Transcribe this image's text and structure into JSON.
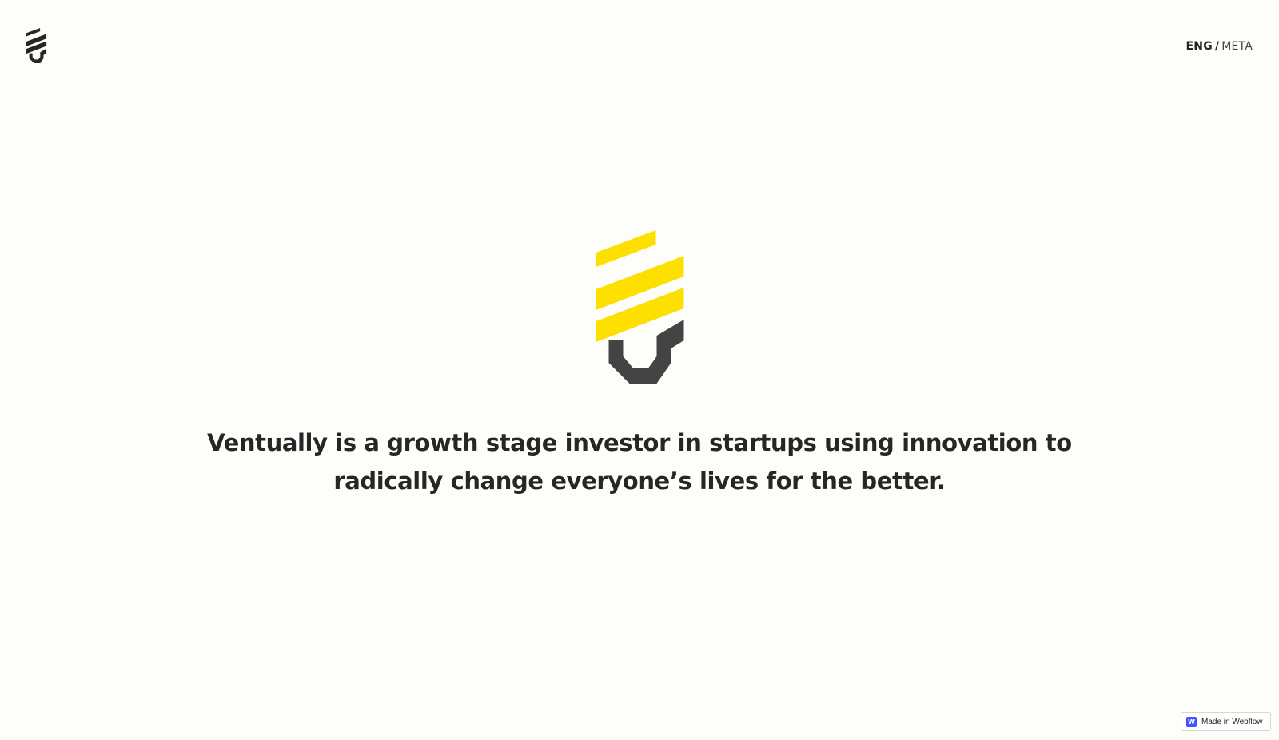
{
  "header": {
    "logo_icon": "ventually-logo-icon",
    "language": {
      "active": "ENG",
      "separator": "/",
      "other": "META"
    }
  },
  "hero": {
    "logo_icon": "ventually-bulb-logo-icon",
    "tagline": "Ventually is a growth stage investor in startups using innovation to radically change everyone’s lives for the better."
  },
  "badge": {
    "icon": "webflow-icon",
    "icon_glyph": "W",
    "label": "Made in Webflow"
  },
  "colors": {
    "background": "#fdfdfa",
    "text": "#262626",
    "accent_yellow": "#fee000",
    "logo_dark": "#444444",
    "webflow_blue": "#4353ff"
  }
}
